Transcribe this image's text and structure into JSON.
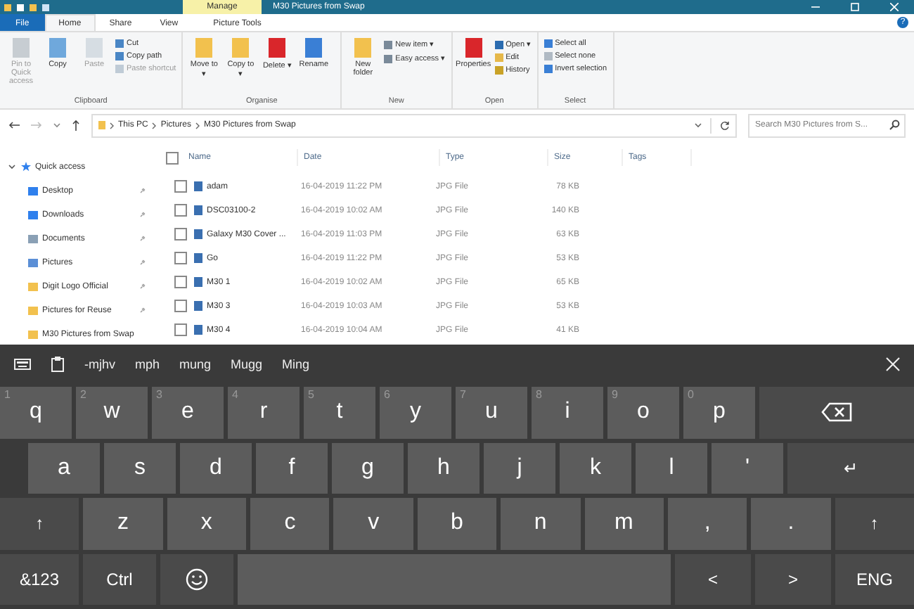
{
  "window": {
    "title": "M30 Pictures from Swap",
    "context_tab": "Manage",
    "context_group": "Picture Tools",
    "help_button": "?"
  },
  "tabs": [
    {
      "label": "File",
      "selected": false
    },
    {
      "label": "Home",
      "selected": true
    },
    {
      "label": "Share",
      "selected": false
    },
    {
      "label": "View",
      "selected": false
    }
  ],
  "ribbon": [
    {
      "group": "Clipboard",
      "buttons": [
        {
          "label": "Pin to Quick access",
          "kind": "large",
          "disabled": true
        },
        {
          "label": "Copy",
          "kind": "large",
          "disabled": false
        },
        {
          "label": "Paste",
          "kind": "large",
          "disabled": true
        },
        {
          "label": "Cut",
          "kind": "small",
          "disabled": false
        },
        {
          "label": "Copy path",
          "kind": "small",
          "disabled": false
        },
        {
          "label": "Paste shortcut",
          "kind": "small",
          "disabled": true
        }
      ]
    },
    {
      "group": "Organise",
      "buttons": [
        {
          "label": "Move to ▾",
          "kind": "large",
          "disabled": false
        },
        {
          "label": "Copy to ▾",
          "kind": "large",
          "disabled": false
        },
        {
          "label": "Delete ▾",
          "kind": "large",
          "disabled": false
        },
        {
          "label": "Rename",
          "kind": "large",
          "disabled": false
        }
      ]
    },
    {
      "group": "New",
      "buttons": [
        {
          "label": "New folder",
          "kind": "large",
          "disabled": false
        },
        {
          "label": "New item ▾",
          "kind": "small",
          "disabled": false
        },
        {
          "label": "Easy access ▾",
          "kind": "small",
          "disabled": false
        }
      ]
    },
    {
      "group": "Open",
      "buttons": [
        {
          "label": "Properties",
          "kind": "large",
          "disabled": false
        },
        {
          "label": "Open ▾",
          "kind": "small",
          "disabled": false
        },
        {
          "label": "Edit",
          "kind": "small",
          "disabled": false
        },
        {
          "label": "History",
          "kind": "small",
          "disabled": false
        }
      ]
    },
    {
      "group": "Select",
      "buttons": [
        {
          "label": "Select all",
          "kind": "small",
          "disabled": false
        },
        {
          "label": "Select none",
          "kind": "small",
          "disabled": false
        },
        {
          "label": "Invert selection",
          "kind": "small",
          "disabled": false
        }
      ]
    }
  ],
  "address": {
    "path": [
      "This PC",
      "Pictures",
      "M30 Pictures from Swap"
    ],
    "search_placeholder": "Search M30 Pictures from S..."
  },
  "sidebar": {
    "items": [
      {
        "label": "Quick access",
        "expanded": true,
        "children": [
          {
            "label": "Desktop",
            "pinned": true
          },
          {
            "label": "Downloads",
            "pinned": true
          },
          {
            "label": "Documents",
            "pinned": true
          },
          {
            "label": "Pictures",
            "pinned": true
          },
          {
            "label": "Digit Logo Official",
            "pinned": true
          },
          {
            "label": "Pictures for Reuse",
            "pinned": true
          },
          {
            "label": "M30 Pictures from Swap",
            "pinned": false
          }
        ]
      }
    ]
  },
  "table": {
    "columns": [
      "Name",
      "Date",
      "Type",
      "Size",
      "Tags"
    ],
    "all_checked": false,
    "rows": [
      {
        "name": "adam",
        "date": "16-04-2019 11:22 PM",
        "type": "JPG File",
        "size": "78 KB",
        "checked": false
      },
      {
        "name": "DSC03100-2",
        "date": "16-04-2019 10:02 AM",
        "type": "JPG File",
        "size": "140 KB",
        "checked": false
      },
      {
        "name": "Galaxy M30 Cover ...",
        "date": "16-04-2019 11:03 PM",
        "type": "JPG File",
        "size": "63 KB",
        "checked": false
      },
      {
        "name": "Go",
        "date": "16-04-2019 11:22 PM",
        "type": "JPG File",
        "size": "53 KB",
        "checked": false
      },
      {
        "name": "M30 1",
        "date": "16-04-2019 10:02 AM",
        "type": "JPG File",
        "size": "65 KB",
        "checked": false
      },
      {
        "name": "M30 3",
        "date": "16-04-2019 10:03 AM",
        "type": "JPG File",
        "size": "53 KB",
        "checked": false
      },
      {
        "name": "M30 4",
        "date": "16-04-2019 10:04 AM",
        "type": "JPG File",
        "size": "41 KB",
        "checked": false
      }
    ]
  },
  "keyboard": {
    "suggestions": [
      "-mjhv",
      "mph",
      "mung",
      "Mugg",
      "Ming"
    ],
    "rows": [
      [
        {
          "label": "q",
          "hint": "1",
          "kind": "char"
        },
        {
          "label": "w",
          "hint": "2",
          "kind": "char"
        },
        {
          "label": "e",
          "hint": "3",
          "kind": "char"
        },
        {
          "label": "r",
          "hint": "4",
          "kind": "char"
        },
        {
          "label": "t",
          "hint": "5",
          "kind": "char"
        },
        {
          "label": "y",
          "hint": "6",
          "kind": "char"
        },
        {
          "label": "u",
          "hint": "7",
          "kind": "char"
        },
        {
          "label": "i",
          "hint": "8",
          "kind": "char"
        },
        {
          "label": "o",
          "hint": "9",
          "kind": "char"
        },
        {
          "label": "p",
          "hint": "0",
          "kind": "char"
        },
        {
          "kind": "backspace"
        }
      ],
      [
        {
          "label": "a",
          "kind": "char"
        },
        {
          "label": "s",
          "kind": "char"
        },
        {
          "label": "d",
          "kind": "char"
        },
        {
          "label": "f",
          "kind": "char"
        },
        {
          "label": "g",
          "kind": "char"
        },
        {
          "label": "h",
          "kind": "char"
        },
        {
          "label": "j",
          "kind": "char"
        },
        {
          "label": "k",
          "kind": "char"
        },
        {
          "label": "l",
          "kind": "char"
        },
        {
          "label": "'",
          "kind": "char"
        },
        {
          "label": "↵",
          "kind": "mod"
        }
      ],
      [
        {
          "label": "↑",
          "kind": "mod"
        },
        {
          "label": "z",
          "kind": "char"
        },
        {
          "label": "x",
          "kind": "char"
        },
        {
          "label": "c",
          "kind": "char"
        },
        {
          "label": "v",
          "kind": "char"
        },
        {
          "label": "b",
          "kind": "char"
        },
        {
          "label": "n",
          "kind": "char"
        },
        {
          "label": "m",
          "kind": "char"
        },
        {
          "label": ",",
          "kind": "char"
        },
        {
          "label": ".",
          "kind": "char"
        },
        {
          "label": "↑",
          "kind": "mod"
        }
      ],
      [
        {
          "label": "&123",
          "kind": "mod"
        },
        {
          "label": "Ctrl",
          "kind": "mod"
        },
        {
          "kind": "emoji"
        },
        {
          "kind": "space"
        },
        {
          "label": "<",
          "kind": "mod"
        },
        {
          "label": ">",
          "kind": "mod"
        },
        {
          "label": "ENG",
          "kind": "mod"
        }
      ]
    ]
  }
}
